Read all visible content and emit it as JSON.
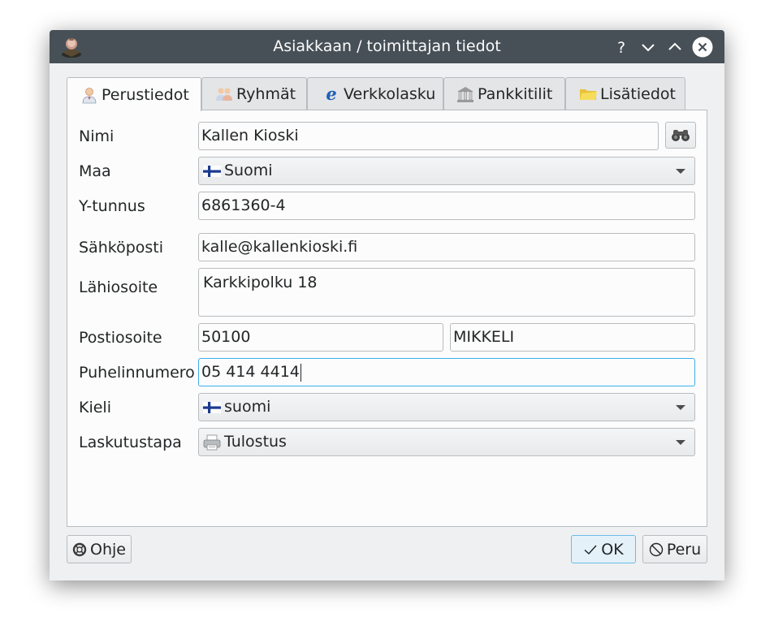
{
  "window": {
    "title": "Asiakkaan / toimittajan tiedot",
    "help_glyph": "?",
    "titlebar_buttons": [
      "help-icon",
      "minimize-icon",
      "maximize-icon",
      "close-icon"
    ]
  },
  "tabs": [
    {
      "label": "Perustiedot",
      "icon": "person-icon",
      "active": true
    },
    {
      "label": "Ryhmät",
      "icon": "group-icon",
      "active": false
    },
    {
      "label": "Verkkolasku",
      "icon": "einvoice-icon",
      "active": false
    },
    {
      "label": "Pankkitilit",
      "icon": "bank-icon",
      "active": false
    },
    {
      "label": "Lisätiedot",
      "icon": "folder-icon",
      "active": false
    }
  ],
  "form": {
    "name": {
      "label": "Nimi",
      "value": "Kallen Kioski"
    },
    "country": {
      "label": "Maa",
      "value": "Suomi",
      "icon": "finland-flag-icon"
    },
    "business_id": {
      "label": "Y-tunnus",
      "value": "6861360-4"
    },
    "email": {
      "label": "Sähköposti",
      "value": "kalle@kallenkioski.fi"
    },
    "street": {
      "label": "Lähiosoite",
      "value": "Karkkipolku 18"
    },
    "postal": {
      "label": "Postiosoite",
      "code": "50100",
      "city": "MIKKELI"
    },
    "phone": {
      "label": "Puhelinnumero",
      "value": "05 414 4414"
    },
    "language": {
      "label": "Kieli",
      "value": "suomi",
      "icon": "finland-flag-icon"
    },
    "billing": {
      "label": "Laskutustapa",
      "value": "Tulostus",
      "icon": "printer-icon"
    }
  },
  "buttons": {
    "help": "Ohje",
    "ok": "OK",
    "cancel": "Peru"
  },
  "colors": {
    "titlebar": "#475057",
    "focus": "#3daee9",
    "finland_blue": "#1a3a8f"
  }
}
